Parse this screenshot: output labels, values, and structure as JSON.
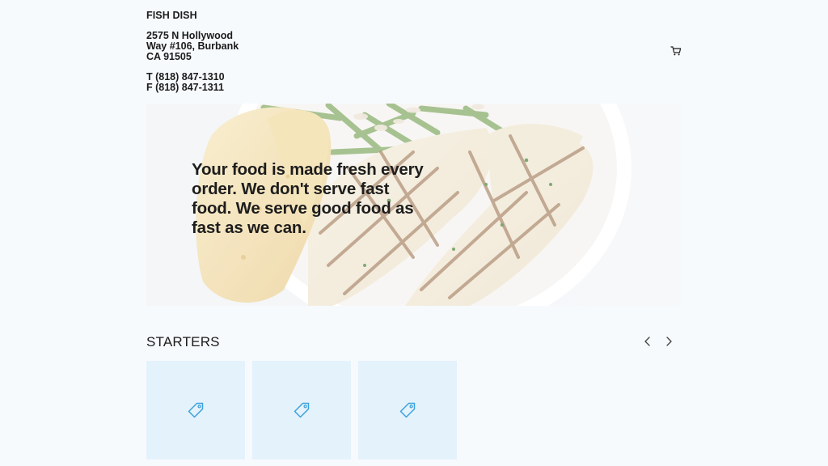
{
  "restaurant": {
    "name": "FISH DISH",
    "address_lines": [
      "2575 N Hollywood",
      "Way #106, Burbank",
      "CA 91505"
    ],
    "phone": "T (818) 847-1310",
    "fax": "F (818) 847-1311"
  },
  "header": {
    "cart_icon": "cart-icon"
  },
  "hero": {
    "tagline": "Your food is made fresh every order. We don't serve fast food. We serve good food as fast as we can."
  },
  "section": {
    "title": "STARTERS",
    "prev_icon": "chevron-left-icon",
    "next_icon": "chevron-right-icon"
  },
  "products": [
    {
      "icon": "price-tag-icon"
    },
    {
      "icon": "price-tag-icon"
    },
    {
      "icon": "price-tag-icon"
    }
  ],
  "colors": {
    "page_bg": "#f7fafd",
    "card_bg": "#e4f2fc",
    "tag_icon": "#3ea2dc",
    "text": "#1b1b1b"
  }
}
